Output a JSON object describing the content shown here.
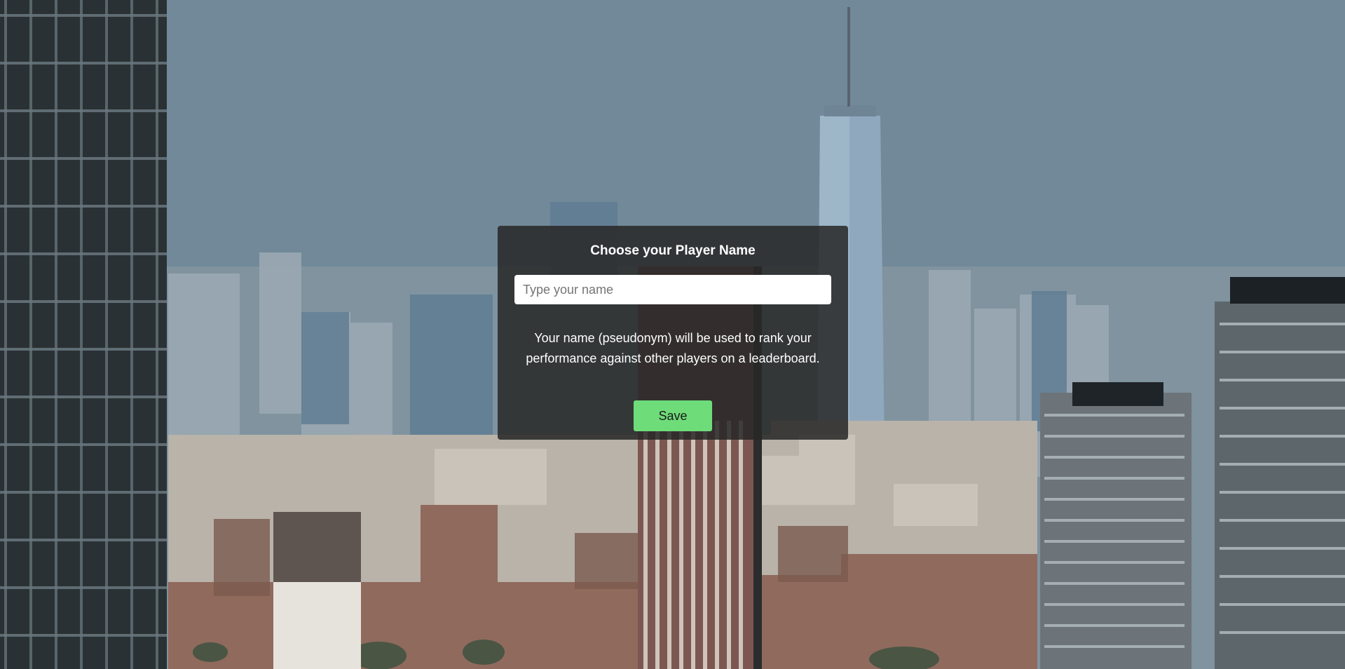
{
  "dialog": {
    "title": "Choose your Player Name",
    "input_placeholder": "Type your name",
    "input_value": "",
    "hint": "Your name (pseudonym) will be used to rank your performance against other players on a leaderboard.",
    "save_label": "Save"
  },
  "colors": {
    "save_button": "#6fdc7a",
    "dialog_background": "#282828"
  }
}
